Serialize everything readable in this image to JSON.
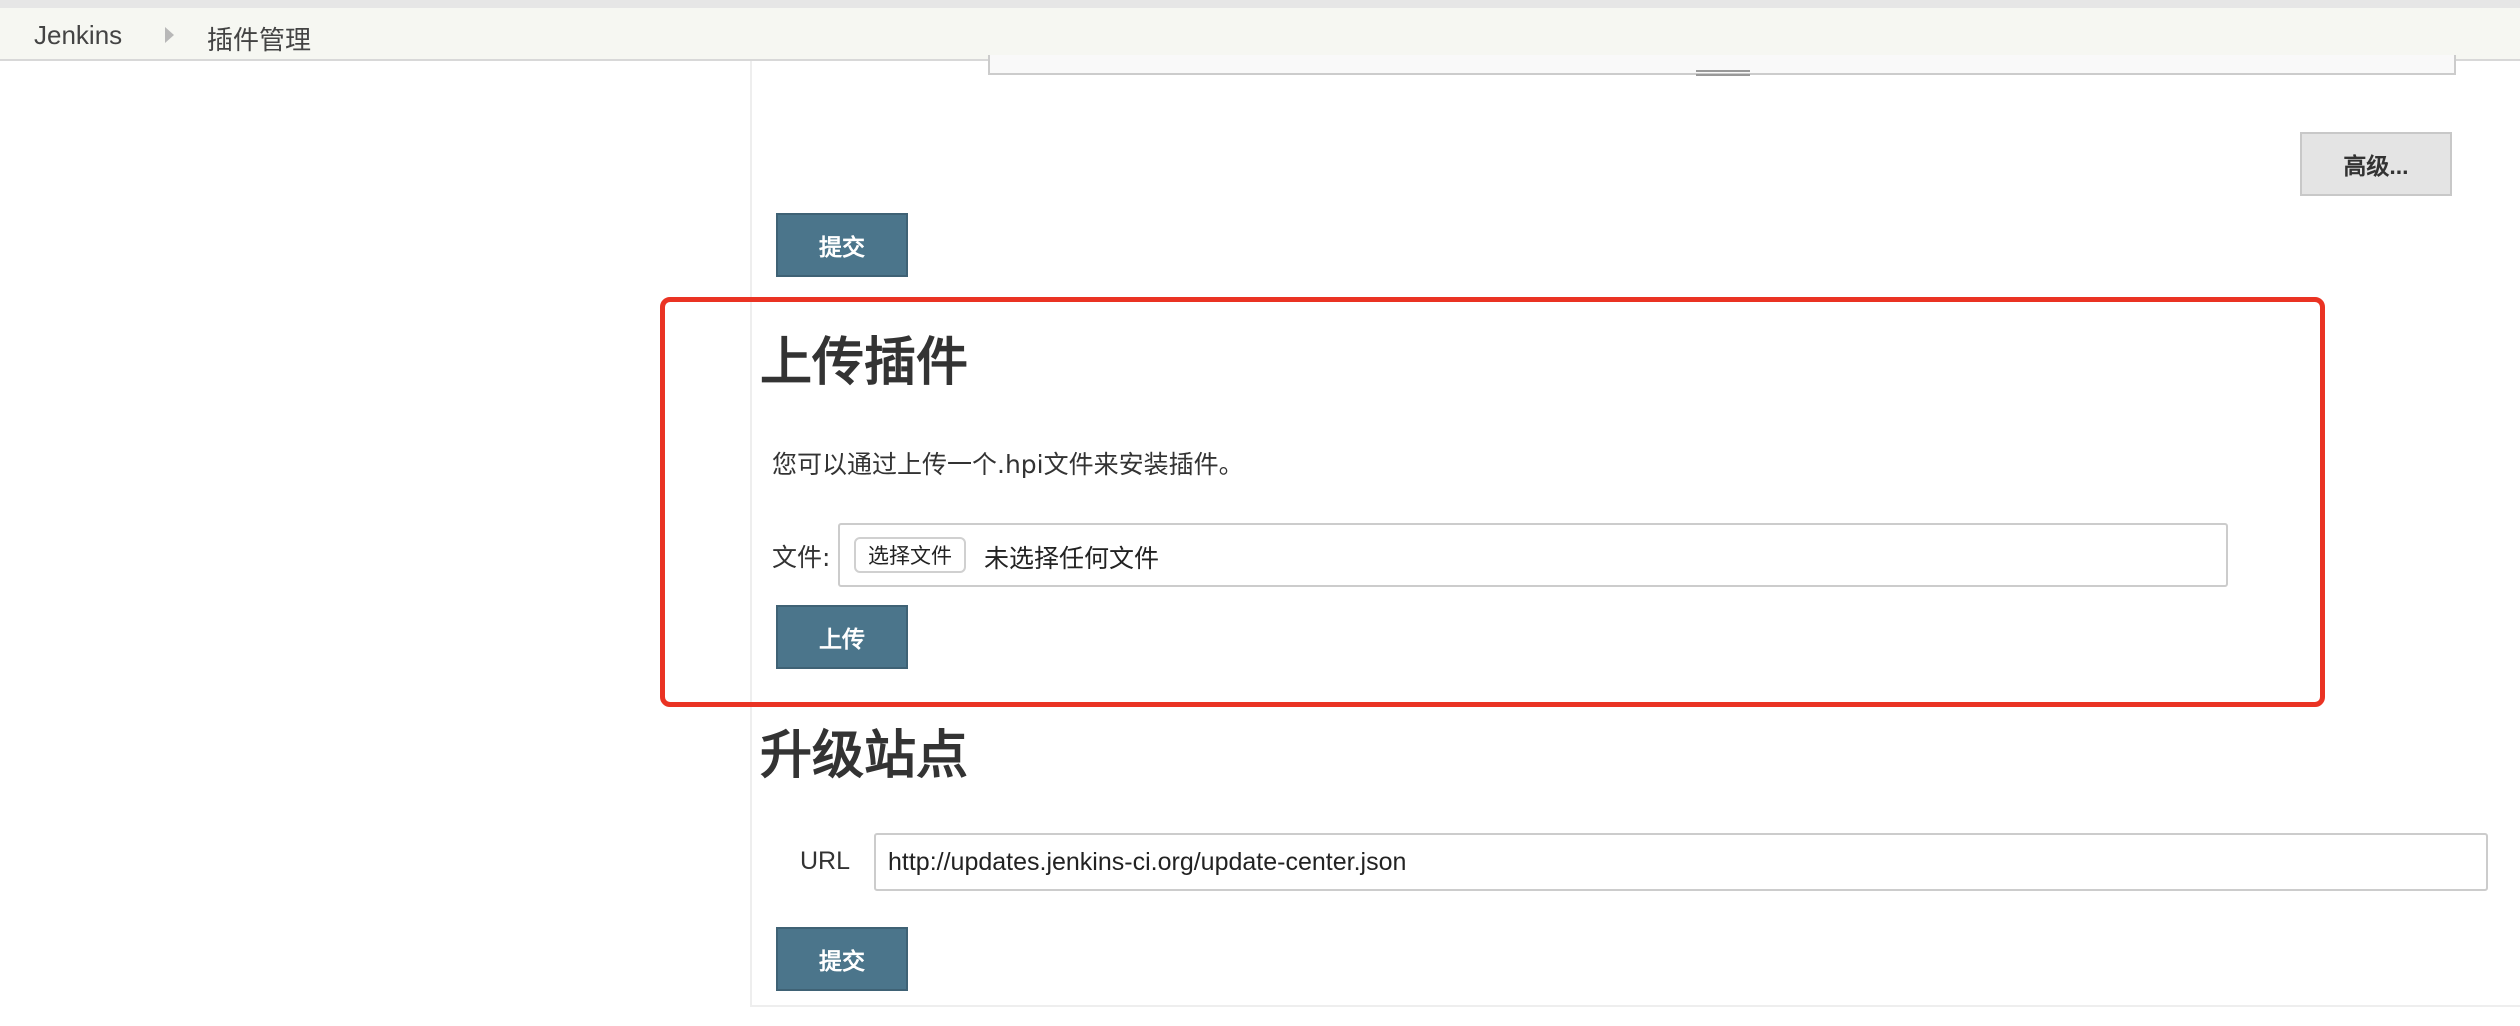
{
  "breadcrumb": {
    "home": "Jenkins",
    "current": "插件管理"
  },
  "advanced": {
    "button_label": "高级..."
  },
  "top_form": {
    "submit_label": "提交"
  },
  "upload_plugin": {
    "title": "上传插件",
    "description": "您可以通过上传一个.hpi文件来安装插件。",
    "file_label": "文件:",
    "choose_file_label": "选择文件",
    "no_file_text": "未选择任何文件",
    "upload_label": "上传"
  },
  "update_site": {
    "title": "升级站点",
    "url_label": "URL",
    "url_value": "http://updates.jenkins-ci.org/update-center.json",
    "submit_label": "提交"
  },
  "highlight": {
    "color": "#ea3323"
  },
  "theme": {
    "primary_button": "#4b758b"
  }
}
